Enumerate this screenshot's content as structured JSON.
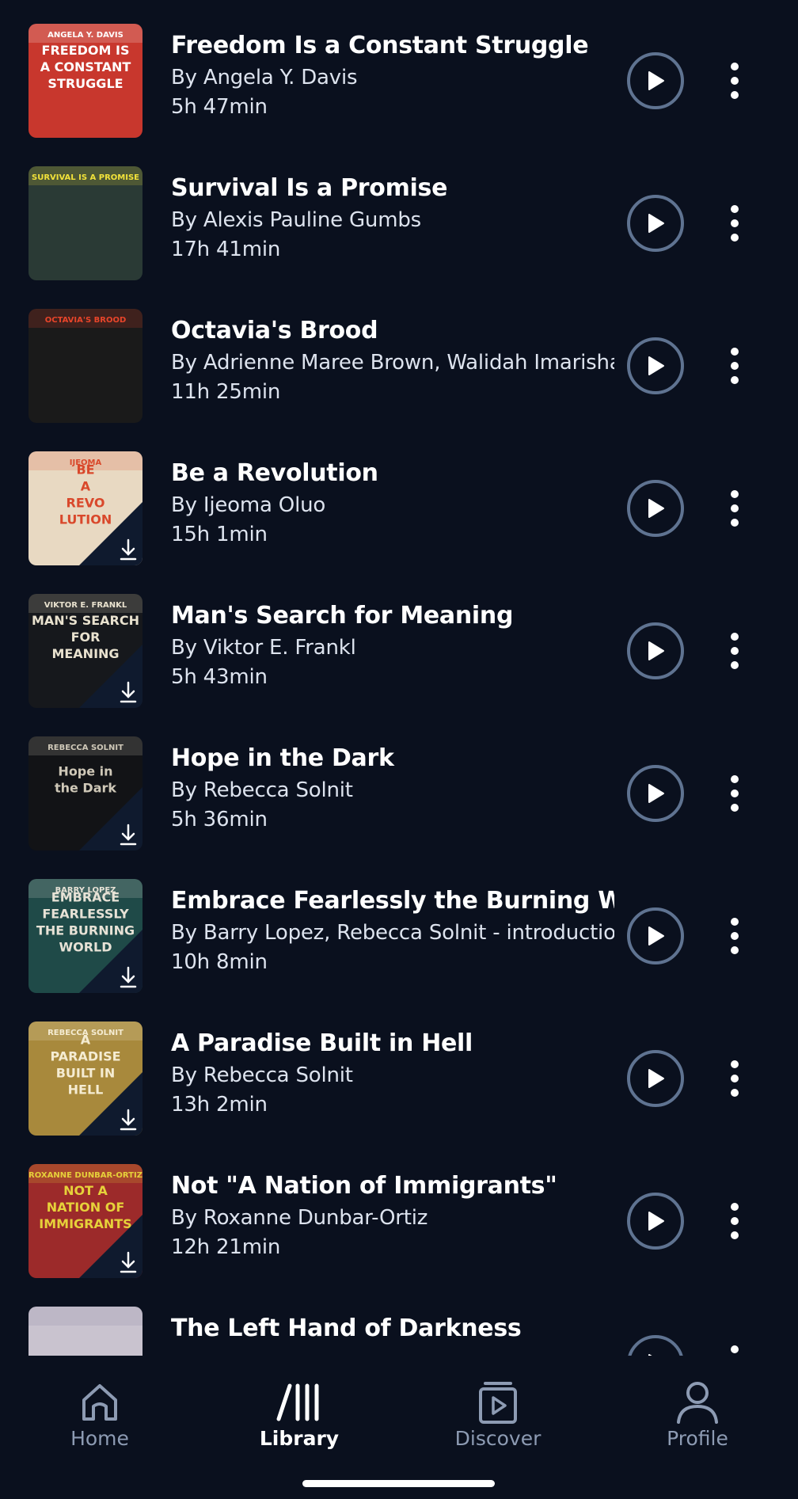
{
  "books": [
    {
      "title": "Freedom Is a Constant Struggle",
      "author": "By Angela Y. Davis",
      "duration": "5h 47min",
      "downloaded": false,
      "cover": {
        "bg": "#c8372d",
        "accent": "#ffffff",
        "lines": [
          "FREEDOM IS",
          "A CONSTANT",
          "STRUGGLE"
        ],
        "top": "ANGELA Y. DAVIS"
      }
    },
    {
      "title": "Survival Is a Promise",
      "author": "By Alexis Pauline Gumbs",
      "duration": "17h 41min",
      "downloaded": false,
      "cover": {
        "bg": "#2a3a35",
        "accent": "#f2e23a",
        "lines": [],
        "top": "SURVIVAL IS A PROMISE"
      }
    },
    {
      "title": "Octavia's Brood",
      "author": "By Adrienne Maree Brown, Walidah Imarisha",
      "duration": "11h 25min",
      "downloaded": false,
      "cover": {
        "bg": "#1a1a1a",
        "accent": "#e8452a",
        "lines": [],
        "top": "OCTAVIA'S BROOD"
      }
    },
    {
      "title": "Be a Revolution",
      "author": "By Ijeoma Oluo",
      "duration": "15h 1min",
      "downloaded": true,
      "cover": {
        "bg": "#e8d9c2",
        "accent": "#d9482b",
        "lines": [
          "BE",
          "A",
          "REVO",
          "LUTION"
        ],
        "top": "IJEOMA"
      }
    },
    {
      "title": "Man's Search for Meaning",
      "author": "By Viktor E. Frankl",
      "duration": "5h 43min",
      "downloaded": true,
      "cover": {
        "bg": "#16181c",
        "accent": "#e9e2cf",
        "lines": [
          "MAN'S SEARCH",
          "FOR",
          "MEANING"
        ],
        "top": "VIKTOR E. FRANKL"
      }
    },
    {
      "title": "Hope in the Dark",
      "author": "By Rebecca Solnit",
      "duration": "5h 36min",
      "downloaded": true,
      "cover": {
        "bg": "#121316",
        "accent": "#cfc8b8",
        "lines": [
          "Hope in",
          "the Dark"
        ],
        "top": "REBECCA SOLNIT"
      }
    },
    {
      "title": "Embrace Fearlessly the Burning World",
      "author": "By Barry Lopez, Rebecca Solnit - introduction",
      "duration": "10h 8min",
      "downloaded": true,
      "cover": {
        "bg": "#1f4a48",
        "accent": "#e7e2d6",
        "lines": [
          "EMBRACE",
          "FEARLESSLY",
          "THE BURNING",
          "WORLD"
        ],
        "top": "BARRY LOPEZ"
      }
    },
    {
      "title": "A Paradise Built in Hell",
      "author": "By Rebecca Solnit",
      "duration": "13h 2min",
      "downloaded": true,
      "cover": {
        "bg": "#a8893c",
        "accent": "#f5ecd2",
        "lines": [
          "A",
          "PARADISE",
          "BUILT IN",
          "HELL"
        ],
        "top": "REBECCA SOLNIT"
      }
    },
    {
      "title": "Not \"A Nation of Immigrants\"",
      "author": "By Roxanne Dunbar-Ortiz",
      "duration": "12h 21min",
      "downloaded": true,
      "cover": {
        "bg": "#9c2a2a",
        "accent": "#e6d13a",
        "lines": [
          "NOT A",
          "NATION OF",
          "IMMIGRANTS"
        ],
        "top": "ROXANNE DUNBAR-ORTIZ"
      }
    },
    {
      "title": "The Left Hand of Darkness",
      "author": "",
      "duration": "",
      "downloaded": false,
      "cover": {
        "bg": "#c9c3cf",
        "accent": "#8a86a0",
        "lines": [],
        "top": ""
      }
    }
  ],
  "nav": {
    "items": [
      {
        "label": "Home",
        "icon": "home-icon",
        "active": false
      },
      {
        "label": "Library",
        "icon": "library-icon",
        "active": true
      },
      {
        "label": "Discover",
        "icon": "discover-icon",
        "active": false
      },
      {
        "label": "Profile",
        "icon": "profile-icon",
        "active": false
      }
    ]
  },
  "colors": {
    "background": "#0a101e",
    "play_ring": "#5f7391",
    "inactive_nav": "#8d9bb3"
  }
}
